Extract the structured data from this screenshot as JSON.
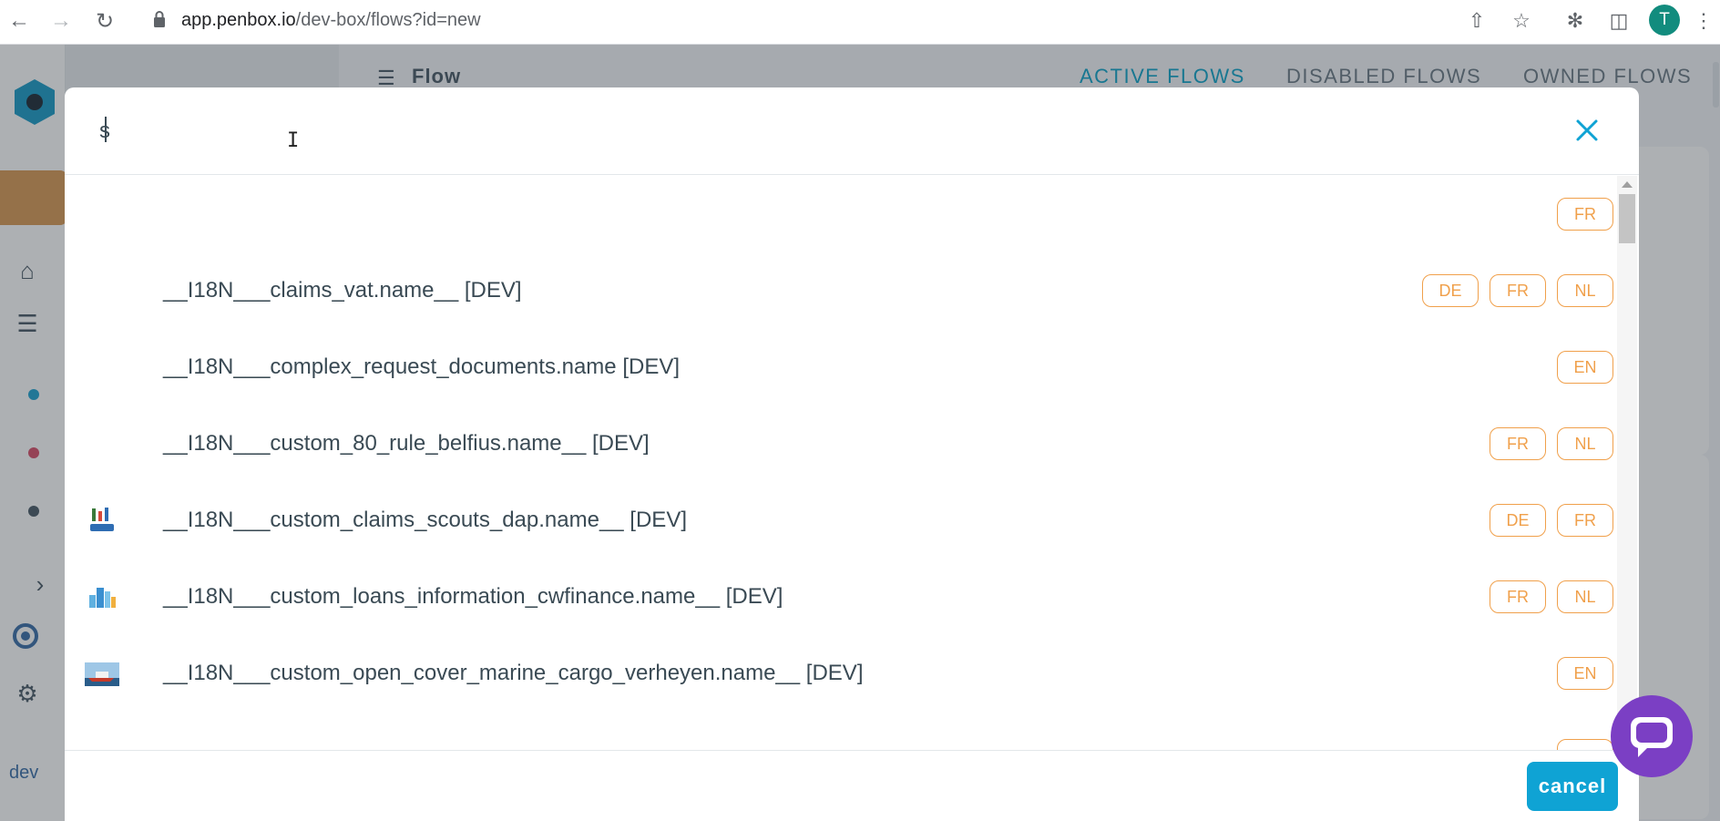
{
  "browser": {
    "url_host": "app.penbox.io",
    "url_path": "/dev-box/flows?id=new",
    "profile_initial": "T"
  },
  "sidebar": {
    "env_label": "dev",
    "dot_colors": [
      "#1fa3d1",
      "#d8506a",
      "#4a5a66"
    ],
    "brand_color": "#1a9bc7"
  },
  "header": {
    "title": "Flow",
    "tabs": [
      {
        "label": "ACTIVE FLOWS",
        "active": true
      },
      {
        "label": "DISABLED FLOWS",
        "active": false
      },
      {
        "label": "OWNED FLOWS",
        "active": false
      }
    ]
  },
  "modal": {
    "search_value": "s",
    "cancel_label": "cancel",
    "flows": [
      {
        "name": "",
        "thumb": "",
        "langs": [
          "FR"
        ]
      },
      {
        "name": "__I18N___claims_vat.name__ [DEV]",
        "thumb": "",
        "langs": [
          "DE",
          "FR",
          "NL"
        ]
      },
      {
        "name": "__I18N___complex_request_documents.name [DEV]",
        "thumb": "",
        "langs": [
          "EN"
        ]
      },
      {
        "name": "__I18N___custom_80_rule_belfius.name__ [DEV]",
        "thumb": "",
        "langs": [
          "FR",
          "NL"
        ]
      },
      {
        "name": "__I18N___custom_claims_scouts_dap.name__ [DEV]",
        "thumb": "scouts-logo",
        "langs": [
          "DE",
          "FR"
        ]
      },
      {
        "name": "__I18N___custom_loans_information_cwfinance.name__ [DEV]",
        "thumb": "city-logo",
        "langs": [
          "FR",
          "NL"
        ]
      },
      {
        "name": "__I18N___custom_open_cover_marine_cargo_verheyen.name__ [DEV]",
        "thumb": "ship-photo",
        "langs": [
          "EN"
        ]
      }
    ]
  },
  "colors": {
    "accent": "#0fa3d4",
    "badge": "#f0a04b",
    "chat": "#7b3fc4"
  }
}
